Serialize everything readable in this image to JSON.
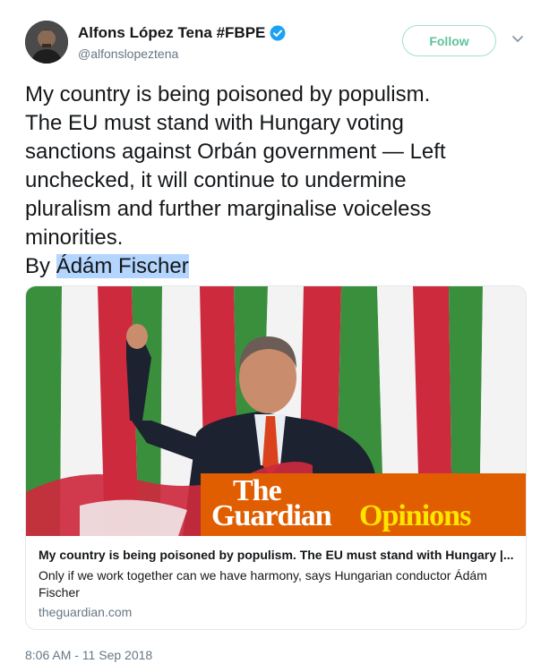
{
  "author": {
    "display_name": "Alfons López Tena #FBPE",
    "handle": "@alfonslopeztena",
    "verified": true
  },
  "actions": {
    "follow_label": "Follow",
    "more_icon": "chevron-down-icon"
  },
  "tweet": {
    "text_main": "My country is being poisoned by populism.\nThe EU must stand with Hungary voting\nsanctions against Orbán government — Left\nunchecked, it will continue to undermine\npluralism and further marginalise voiceless\nminorities.\nBy ",
    "text_highlight": "Ádám Fischer",
    "timestamp": "8:06 AM - 11 Sep 2018"
  },
  "card": {
    "logo_the": "The",
    "logo_guardian": "Guardian",
    "logo_opinions": "Opinions",
    "title": "My country is being poisoned by populism. The EU must stand with Hungary |...",
    "description": "Only if we work together can we have harmony, says Hungarian conductor Ádám Fischer",
    "domain": "theguardian.com"
  },
  "colors": {
    "verified": "#1da1f2",
    "follow_accent": "#5fc39a",
    "guardian_orange": "#e05e00",
    "guardian_yellow": "#ffe500",
    "flag_red": "#cd2a3e",
    "flag_green": "#3a8f3c"
  }
}
